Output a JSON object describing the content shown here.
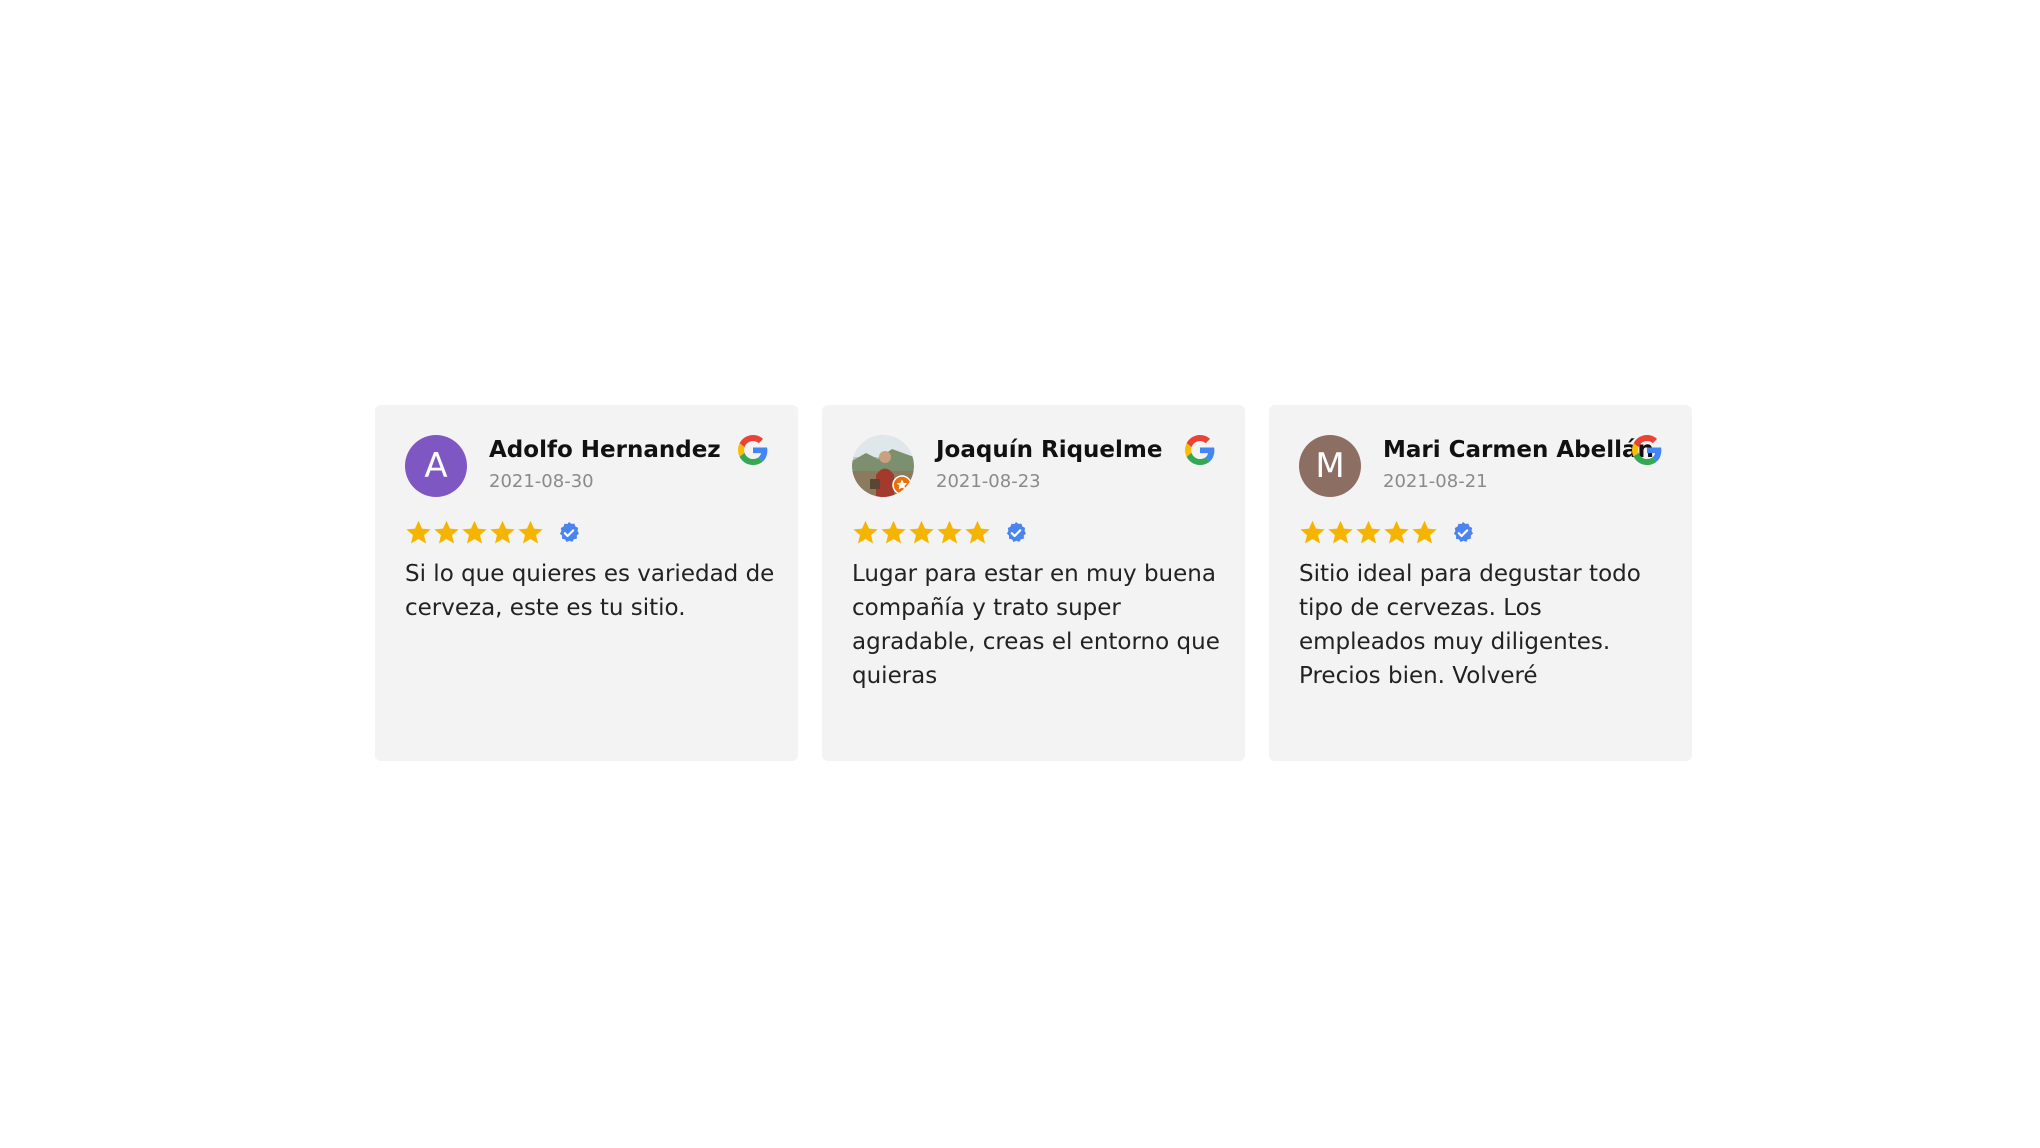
{
  "colors": {
    "card_background": "#f3f3f3",
    "star": "#f4b400",
    "verified": "#4a84f0",
    "date_text": "#8a8a8a"
  },
  "reviews": [
    {
      "name": "Adolfo Hernandez",
      "date": "2021-08-30",
      "avatar": {
        "type": "initial",
        "initial": "A",
        "color": "#7e57c2"
      },
      "rating": 5,
      "verified": true,
      "source_icon": "google-icon",
      "text": "Si lo que quieres es variedad de cerveza, este es tu sitio."
    },
    {
      "name": "Joaquín Riquelme",
      "date": "2021-08-23",
      "avatar": {
        "type": "photo",
        "badge": "local-guide-star-icon"
      },
      "rating": 5,
      "verified": true,
      "source_icon": "google-icon",
      "text": "Lugar para estar en muy buena compañía y trato super agradable, creas el entorno que quieras"
    },
    {
      "name": "Mari Carmen Abellán",
      "date": "2021-08-21",
      "avatar": {
        "type": "initial",
        "initial": "M",
        "color": "#8d6e63"
      },
      "rating": 5,
      "verified": true,
      "source_icon": "google-icon",
      "text": "Sitio ideal para degustar todo tipo de cervezas. Los empleados muy diligentes. Precios bien. Volveré"
    }
  ]
}
